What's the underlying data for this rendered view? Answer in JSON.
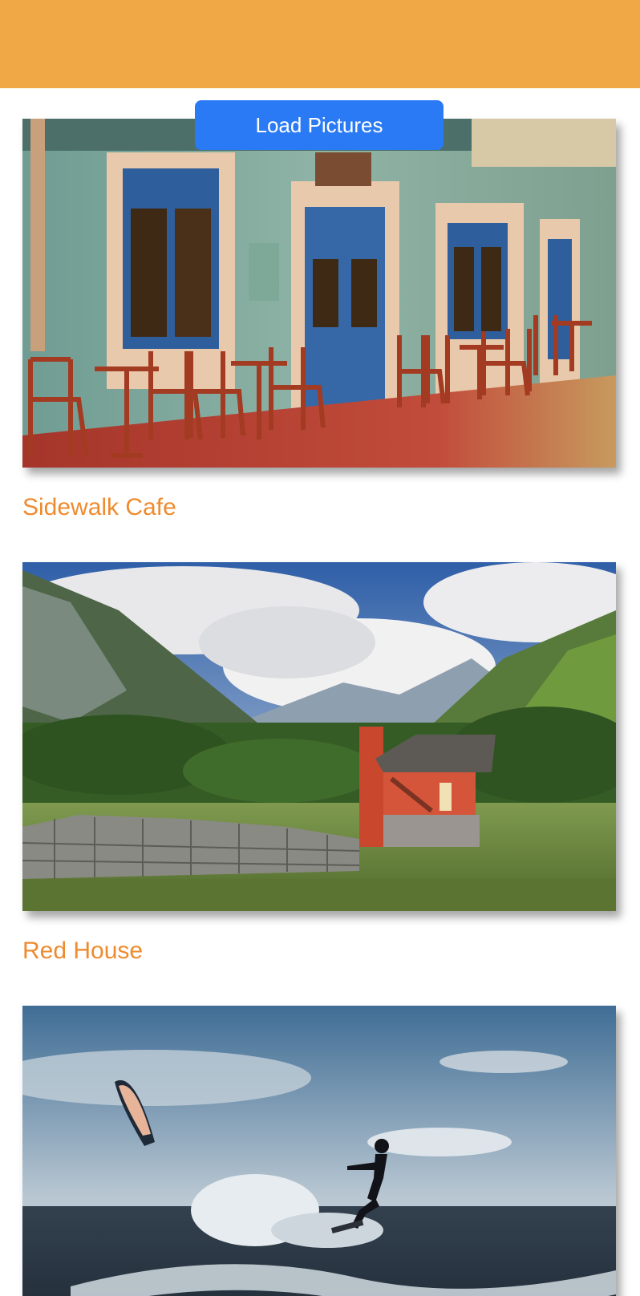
{
  "toolbar": {
    "load_label": "Load Pictures"
  },
  "colors": {
    "nav_bar": "#f0a746",
    "caption": "#ee8b2f",
    "button": "#2a7af5"
  },
  "pictures": [
    {
      "title": "Sidewalk Cafe",
      "image_icon": "photo-cafe-icon"
    },
    {
      "title": "Red House",
      "image_icon": "photo-red-house-icon"
    },
    {
      "title": "",
      "image_icon": "photo-kitesurfer-icon"
    }
  ]
}
